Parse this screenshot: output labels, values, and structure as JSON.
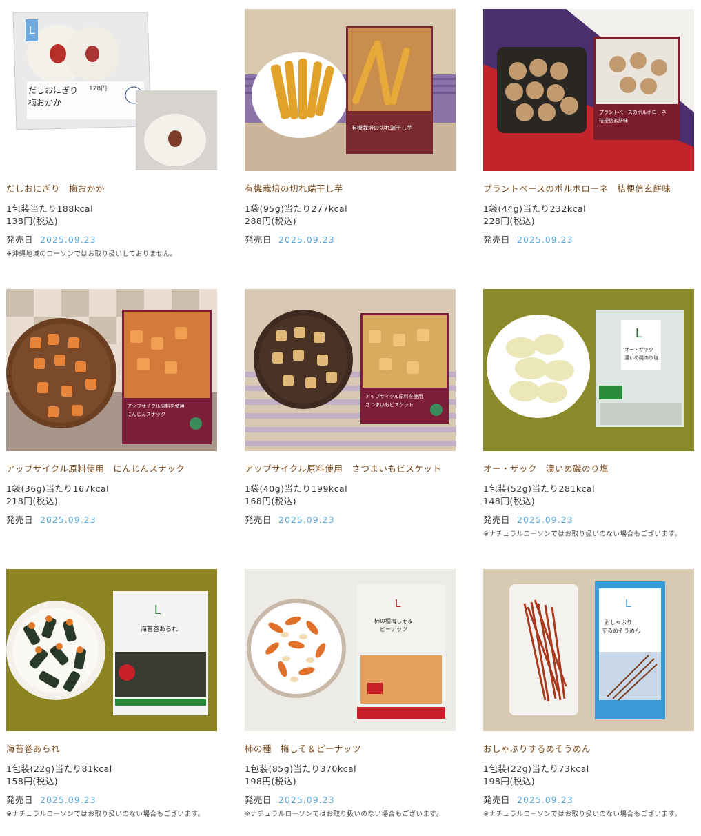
{
  "release_label": "発売日",
  "products": [
    {
      "name": "だしおにぎり　梅おかか",
      "kcal": "1包装当たり188kcal",
      "price": "138円(税込)",
      "date": "2025.09.23",
      "note": "※沖縄地域のローソンではお取り扱いしておりません。",
      "image": "onigiri-photo"
    },
    {
      "name": "有機栽培の切れ端干し芋",
      "kcal": "1袋(95g)当たり277kcal",
      "price": "288円(税込)",
      "date": "2025.09.23",
      "note": "",
      "image": "dried-sweet-potato-photo"
    },
    {
      "name": "プラントベースのポルボローネ　桔梗信玄餅味",
      "kcal": "1袋(44g)当たり232kcal",
      "price": "228円(税込)",
      "date": "2025.09.23",
      "note": "",
      "image": "polvorone-photo"
    },
    {
      "name": "アップサイクル原料使用　にんじんスナック",
      "kcal": "1袋(36g)当たり167kcal",
      "price": "218円(税込)",
      "date": "2025.09.23",
      "note": "",
      "image": "carrot-snack-photo"
    },
    {
      "name": "アップサイクル原料使用　さつまいもビスケット",
      "kcal": "1袋(40g)当たり199kcal",
      "price": "168円(税込)",
      "date": "2025.09.23",
      "note": "",
      "image": "sweet-potato-biscuit-photo"
    },
    {
      "name": "オー・ザック　濃いめ磯のり塩",
      "kcal": "1包装(52g)当たり281kcal",
      "price": "148円(税込)",
      "date": "2025.09.23",
      "note": "※ナチュラルローソンではお取り扱いのない場合もございます。",
      "image": "ozack-chips-photo"
    },
    {
      "name": "海苔巻あられ",
      "kcal": "1包装(22g)当たり81kcal",
      "price": "158円(税込)",
      "date": "2025.09.23",
      "note": "※ナチュラルローソンではお取り扱いのない場合もございます。",
      "image": "norimaki-arare-photo"
    },
    {
      "name": "柿の種　梅しそ＆ピーナッツ",
      "kcal": "1包装(85g)当たり370kcal",
      "price": "198円(税込)",
      "date": "2025.09.23",
      "note": "※ナチュラルローソンではお取り扱いのない場合もございます。",
      "image": "kakinotane-photo"
    },
    {
      "name": "おしゃぶりするめそうめん",
      "kcal": "1包装(22g)当たり73kcal",
      "price": "198円(税込)",
      "date": "2025.09.23",
      "note": "※ナチュラルローソンではお取り扱いのない場合もございます。",
      "image": "surume-somen-photo"
    }
  ],
  "package_labels": {
    "onigiri": "だしおにぎり\n梅おかか",
    "onigiri_price": "128円",
    "imo": "有機栽培の切れ端干し芋",
    "polvo": "プラントベースのポルボローネ\n桔梗信玄餅味",
    "carrot": "アップサイクル原料を使用\nにんじんスナック",
    "biscuit": "アップサイクル原料を使用\nさつまいもビスケット",
    "ozack": "オー・ザック\n濃いめ磯のり塩",
    "arare": "海苔巻あられ",
    "kaki": "柿の種梅しそ＆\nピーナッツ",
    "surume": "おしゃぶり\nするめそうめん"
  }
}
